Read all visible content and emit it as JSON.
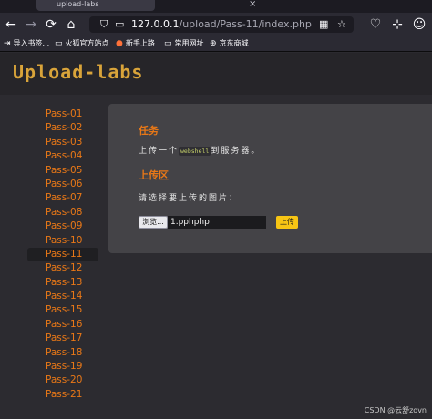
{
  "browser": {
    "tab_title": "upload-labs",
    "nav": {
      "back": "←",
      "forward": "→",
      "reload": "⟳",
      "home": "⌂"
    },
    "url_host": "127.0.0.1",
    "url_path": "/upload/Pass-11/index.php",
    "bookmarks": [
      "导入书签...",
      "火狐官方站点",
      "新手上路",
      "常用网址",
      "京东商城"
    ]
  },
  "header": {
    "logo": "Upload-labs"
  },
  "sidebar": {
    "items": [
      "Pass-01",
      "Pass-02",
      "Pass-03",
      "Pass-04",
      "Pass-05",
      "Pass-06",
      "Pass-07",
      "Pass-08",
      "Pass-09",
      "Pass-10",
      "Pass-11",
      "Pass-12",
      "Pass-13",
      "Pass-14",
      "Pass-15",
      "Pass-16",
      "Pass-17",
      "Pass-18",
      "Pass-19",
      "Pass-20",
      "Pass-21"
    ],
    "active_index": 10
  },
  "main": {
    "task_title": "任务",
    "task_prefix": "上传一个",
    "task_code": "webshell",
    "task_suffix": "到服务器。",
    "upload_title": "上传区",
    "choose_text": "请选择要上传的图片：",
    "browse_label": "浏览...",
    "file_value": "1.pphphp",
    "upload_button": "上传"
  },
  "watermark": "CSDN @云舒zovn"
}
